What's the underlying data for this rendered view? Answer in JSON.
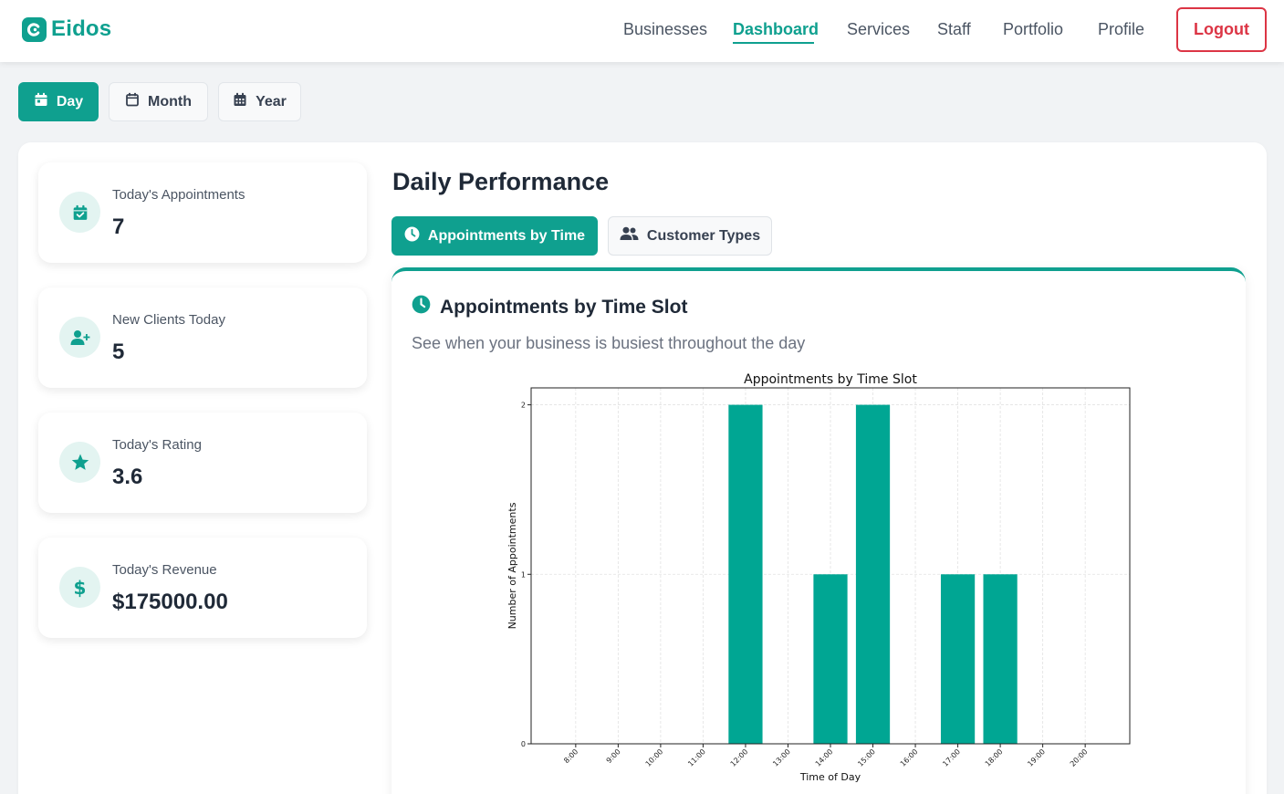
{
  "brand": {
    "name": "Eidos",
    "color": "#0fa08f",
    "logo_icon": "c-logo-icon"
  },
  "nav": {
    "items": [
      {
        "label": "Businesses",
        "active": false
      },
      {
        "label": "Dashboard",
        "active": true
      },
      {
        "label": "Services",
        "active": false
      },
      {
        "label": "Staff",
        "active": false
      },
      {
        "label": "Portfolio",
        "active": false
      },
      {
        "label": "Profile",
        "active": false
      }
    ],
    "logout_label": "Logout"
  },
  "period": {
    "buttons": [
      {
        "label": "Day",
        "icon": "calendar-day-icon",
        "active": true
      },
      {
        "label": "Month",
        "icon": "calendar-icon",
        "active": false
      },
      {
        "label": "Year",
        "icon": "calendar-grid-icon",
        "active": false
      }
    ]
  },
  "stats": [
    {
      "label": "Today's Appointments",
      "value": "7",
      "icon": "calendar-check-icon"
    },
    {
      "label": "New Clients Today",
      "value": "5",
      "icon": "user-plus-icon"
    },
    {
      "label": "Today's Rating",
      "value": "3.6",
      "icon": "star-icon"
    },
    {
      "label": "Today's Revenue",
      "value": "$175000.00",
      "icon": "dollar-icon"
    }
  ],
  "performance": {
    "title": "Daily Performance",
    "tabs": [
      {
        "label": "Appointments by Time",
        "icon": "clock-icon",
        "active": true
      },
      {
        "label": "Customer Types",
        "icon": "users-icon",
        "active": false
      }
    ],
    "card_title": "Appointments by Time Slot",
    "card_subtitle": "See when your business is busiest throughout the day"
  },
  "chart_data": {
    "type": "bar",
    "title": "Appointments by Time Slot",
    "xlabel": "Time of Day",
    "ylabel": "Number of Appointments",
    "categories": [
      "8:00",
      "9:00",
      "10:00",
      "11:00",
      "12:00",
      "13:00",
      "14:00",
      "15:00",
      "16:00",
      "17:00",
      "18:00",
      "19:00",
      "20:00"
    ],
    "values": [
      0,
      0,
      0,
      0,
      2,
      0,
      1,
      2,
      0,
      1,
      1,
      0,
      0
    ],
    "ylim": [
      0,
      2.1
    ],
    "yticks": [
      0,
      1,
      2
    ],
    "grid": true,
    "bar_color": "#00a693"
  }
}
